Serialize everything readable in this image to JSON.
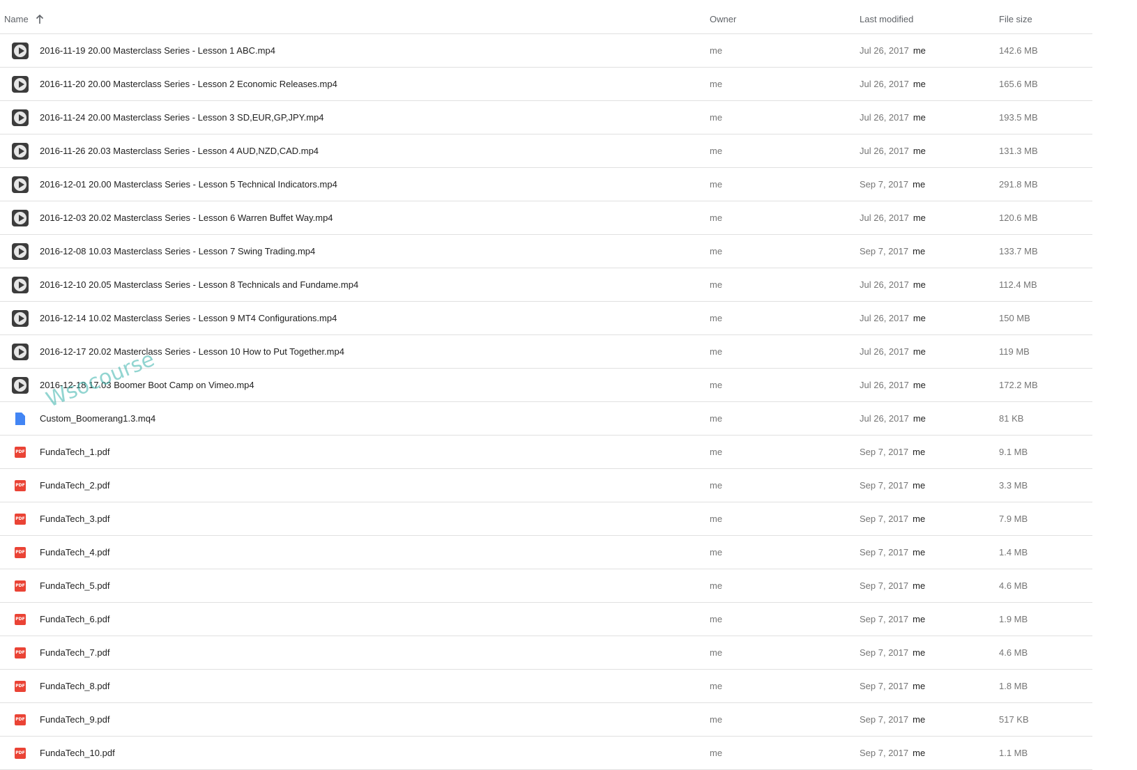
{
  "header": {
    "name_label": "Name",
    "owner_label": "Owner",
    "modified_label": "Last modified",
    "size_label": "File size"
  },
  "files": [
    {
      "icon": "video-icon",
      "name": "2016-11-19 20.00 Masterclass Series - Lesson 1 ABC.mp4",
      "owner": "me",
      "modified": "Jul 26, 2017",
      "modified_by": "me",
      "size": "142.6 MB"
    },
    {
      "icon": "video-icon",
      "name": "2016-11-20 20.00 Masterclass Series - Lesson 2 Economic Releases.mp4",
      "owner": "me",
      "modified": "Jul 26, 2017",
      "modified_by": "me",
      "size": "165.6 MB"
    },
    {
      "icon": "video-icon",
      "name": "2016-11-24 20.00 Masterclass Series - Lesson 3 SD,EUR,GP,JPY.mp4",
      "owner": "me",
      "modified": "Jul 26, 2017",
      "modified_by": "me",
      "size": "193.5 MB"
    },
    {
      "icon": "video-icon",
      "name": "2016-11-26 20.03 Masterclass Series - Lesson 4 AUD,NZD,CAD.mp4",
      "owner": "me",
      "modified": "Jul 26, 2017",
      "modified_by": "me",
      "size": "131.3 MB"
    },
    {
      "icon": "video-icon",
      "name": "2016-12-01 20.00 Masterclass Series - Lesson 5 Technical Indicators.mp4",
      "owner": "me",
      "modified": "Sep 7, 2017",
      "modified_by": "me",
      "size": "291.8 MB"
    },
    {
      "icon": "video-icon",
      "name": "2016-12-03 20.02 Masterclass Series - Lesson 6 Warren Buffet Way.mp4",
      "owner": "me",
      "modified": "Jul 26, 2017",
      "modified_by": "me",
      "size": "120.6 MB"
    },
    {
      "icon": "video-icon",
      "name": "2016-12-08 10.03 Masterclass Series - Lesson 7 Swing Trading.mp4",
      "owner": "me",
      "modified": "Sep 7, 2017",
      "modified_by": "me",
      "size": "133.7 MB"
    },
    {
      "icon": "video-icon",
      "name": "2016-12-10 20.05 Masterclass Series - Lesson 8 Technicals and Fundame.mp4",
      "owner": "me",
      "modified": "Jul 26, 2017",
      "modified_by": "me",
      "size": "112.4 MB"
    },
    {
      "icon": "video-icon",
      "name": "2016-12-14 10.02 Masterclass Series - Lesson 9 MT4 Configurations.mp4",
      "owner": "me",
      "modified": "Jul 26, 2017",
      "modified_by": "me",
      "size": "150 MB"
    },
    {
      "icon": "video-icon",
      "name": "2016-12-17 20.02 Masterclass Series - Lesson 10 How to Put Together.mp4",
      "owner": "me",
      "modified": "Jul 26, 2017",
      "modified_by": "me",
      "size": "119 MB"
    },
    {
      "icon": "video-icon",
      "name": "2016-12-18 17.03 Boomer Boot Camp on Vimeo.mp4",
      "owner": "me",
      "modified": "Jul 26, 2017",
      "modified_by": "me",
      "size": "172.2 MB"
    },
    {
      "icon": "doc-icon",
      "name": "Custom_Boomerang1.3.mq4",
      "owner": "me",
      "modified": "Jul 26, 2017",
      "modified_by": "me",
      "size": "81 KB"
    },
    {
      "icon": "pdf-icon",
      "name": "FundaTech_1.pdf",
      "owner": "me",
      "modified": "Sep 7, 2017",
      "modified_by": "me",
      "size": "9.1 MB"
    },
    {
      "icon": "pdf-icon",
      "name": "FundaTech_2.pdf",
      "owner": "me",
      "modified": "Sep 7, 2017",
      "modified_by": "me",
      "size": "3.3 MB"
    },
    {
      "icon": "pdf-icon",
      "name": "FundaTech_3.pdf",
      "owner": "me",
      "modified": "Sep 7, 2017",
      "modified_by": "me",
      "size": "7.9 MB"
    },
    {
      "icon": "pdf-icon",
      "name": "FundaTech_4.pdf",
      "owner": "me",
      "modified": "Sep 7, 2017",
      "modified_by": "me",
      "size": "1.4 MB"
    },
    {
      "icon": "pdf-icon",
      "name": "FundaTech_5.pdf",
      "owner": "me",
      "modified": "Sep 7, 2017",
      "modified_by": "me",
      "size": "4.6 MB"
    },
    {
      "icon": "pdf-icon",
      "name": "FundaTech_6.pdf",
      "owner": "me",
      "modified": "Sep 7, 2017",
      "modified_by": "me",
      "size": "1.9 MB"
    },
    {
      "icon": "pdf-icon",
      "name": "FundaTech_7.pdf",
      "owner": "me",
      "modified": "Sep 7, 2017",
      "modified_by": "me",
      "size": "4.6 MB"
    },
    {
      "icon": "pdf-icon",
      "name": "FundaTech_8.pdf",
      "owner": "me",
      "modified": "Sep 7, 2017",
      "modified_by": "me",
      "size": "1.8 MB"
    },
    {
      "icon": "pdf-icon",
      "name": "FundaTech_9.pdf",
      "owner": "me",
      "modified": "Sep 7, 2017",
      "modified_by": "me",
      "size": "517 KB"
    },
    {
      "icon": "pdf-icon",
      "name": "FundaTech_10.pdf",
      "owner": "me",
      "modified": "Sep 7, 2017",
      "modified_by": "me",
      "size": "1.1 MB"
    }
  ],
  "pdf_icon_label": "PDF",
  "watermark_text": "Wsocourse"
}
